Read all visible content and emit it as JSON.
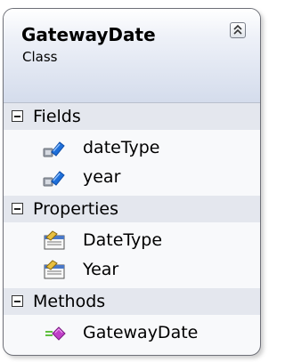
{
  "class": {
    "name": "GatewayDate",
    "kind": "Class"
  },
  "sections": {
    "fields": {
      "label": "Fields",
      "items": [
        {
          "label": "dateType",
          "icon": "field-icon"
        },
        {
          "label": "year",
          "icon": "field-icon"
        }
      ]
    },
    "properties": {
      "label": "Properties",
      "items": [
        {
          "label": "DateType",
          "icon": "property-icon"
        },
        {
          "label": "Year",
          "icon": "property-icon"
        }
      ]
    },
    "methods": {
      "label": "Methods",
      "items": [
        {
          "label": "GatewayDate",
          "icon": "method-icon"
        }
      ]
    }
  },
  "colors": {
    "border": "#6e7078",
    "header_gradient_bottom": "#d4dcec",
    "section_bar": "#e4e7ee",
    "field_icon": "#1e6fd9",
    "method_icon": "#c040c8"
  }
}
